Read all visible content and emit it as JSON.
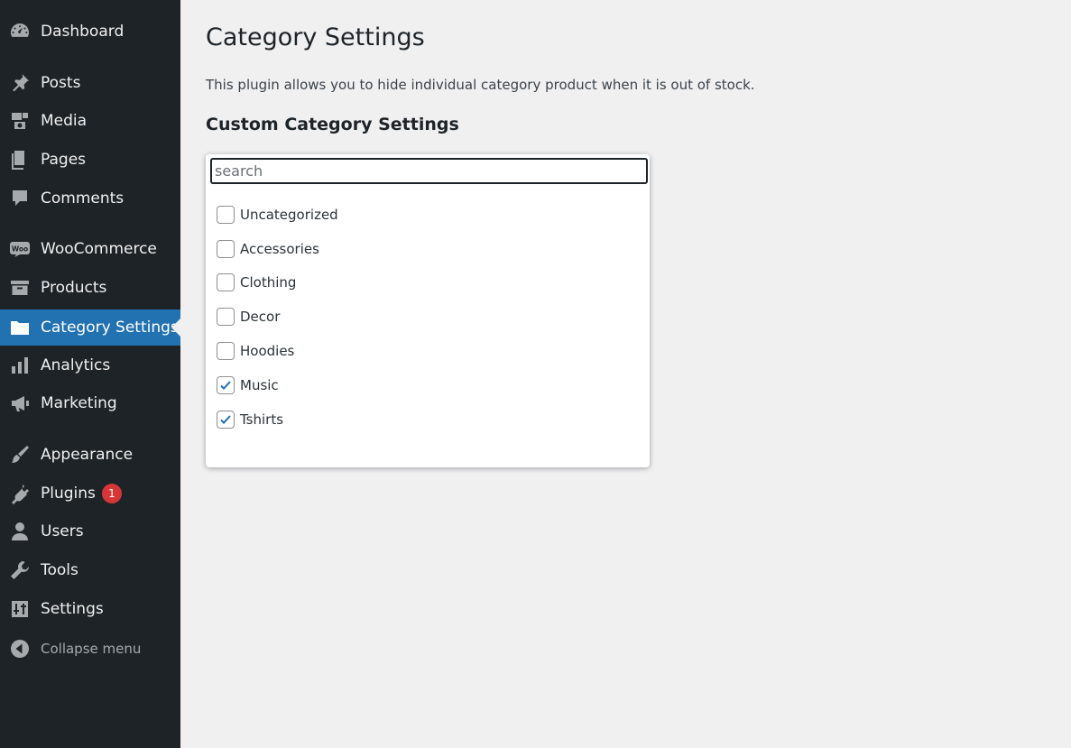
{
  "sidebar": {
    "items": [
      {
        "label": "Dashboard",
        "icon": "dashboard-icon"
      },
      {
        "label": "Posts",
        "icon": "pin-icon"
      },
      {
        "label": "Media",
        "icon": "media-icon"
      },
      {
        "label": "Pages",
        "icon": "pages-icon"
      },
      {
        "label": "Comments",
        "icon": "comment-icon"
      },
      {
        "label": "WooCommerce",
        "icon": "woocommerce-icon"
      },
      {
        "label": "Products",
        "icon": "archive-icon"
      },
      {
        "label": "Category Settings",
        "icon": "folder-icon"
      },
      {
        "label": "Analytics",
        "icon": "bar-chart-icon"
      },
      {
        "label": "Marketing",
        "icon": "megaphone-icon"
      },
      {
        "label": "Appearance",
        "icon": "paintbrush-icon"
      },
      {
        "label": "Plugins",
        "icon": "plug-icon",
        "badge": "1"
      },
      {
        "label": "Users",
        "icon": "user-icon"
      },
      {
        "label": "Tools",
        "icon": "wrench-icon"
      },
      {
        "label": "Settings",
        "icon": "sliders-icon"
      }
    ],
    "collapse_label": "Collapse menu",
    "current": "Category Settings"
  },
  "main": {
    "title": "Category Settings",
    "description": "This plugin allows you to hide individual category product when it is out of stock.",
    "section_title": "Custom Category Settings",
    "search": {
      "placeholder": "search",
      "value": ""
    },
    "categories": [
      {
        "label": "Uncategorized",
        "checked": false
      },
      {
        "label": "Accessories",
        "checked": false
      },
      {
        "label": "Clothing",
        "checked": false
      },
      {
        "label": "Decor",
        "checked": false
      },
      {
        "label": "Hoodies",
        "checked": false
      },
      {
        "label": "Music",
        "checked": true
      },
      {
        "label": "Tshirts",
        "checked": true
      }
    ]
  },
  "colors": {
    "sidebar_bg": "#1d2327",
    "accent": "#2271b1",
    "badge": "#d63638",
    "page_bg": "#f0f0f1"
  }
}
